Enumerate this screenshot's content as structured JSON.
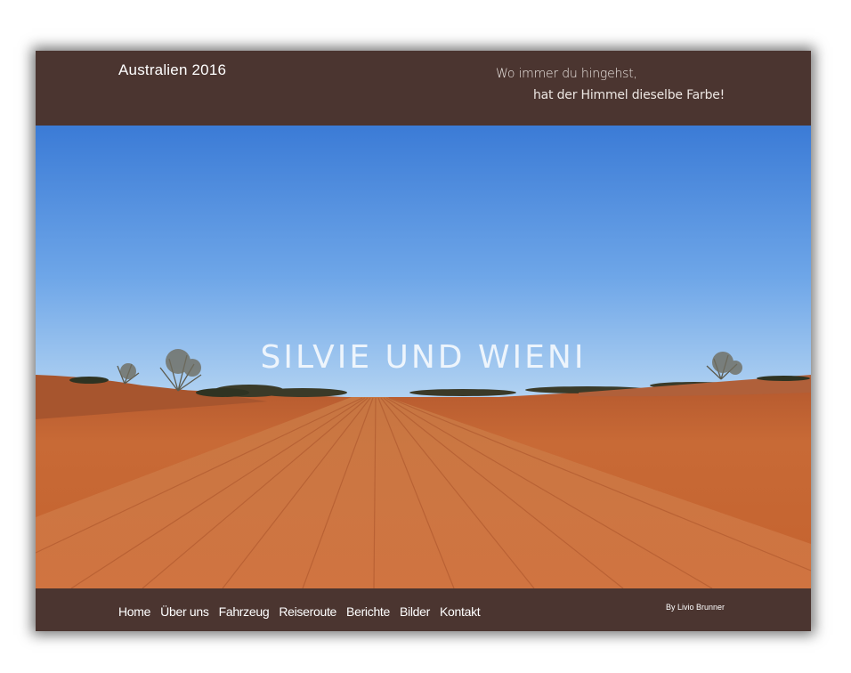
{
  "header": {
    "site_title": "Australien 2016",
    "slogan_line1": "Wo immer du hingehst,",
    "slogan_line2": "hat der Himmel dieselbe Farbe!"
  },
  "hero": {
    "title": "SILVIE UND WIENI",
    "image_description": "red-desert-road-photo"
  },
  "nav": {
    "items": [
      {
        "label": "Home"
      },
      {
        "label": "Über uns"
      },
      {
        "label": "Fahrzeug"
      },
      {
        "label": "Reiseroute"
      },
      {
        "label": "Berichte"
      },
      {
        "label": "Bilder"
      },
      {
        "label": "Kontakt"
      }
    ]
  },
  "footer": {
    "credit": "By Livio Brunner"
  },
  "colors": {
    "bar_background": "#4b3530",
    "sky_top": "#3f7fd8",
    "sky_bottom": "#a9cdf0",
    "ground": "#c8622f"
  }
}
